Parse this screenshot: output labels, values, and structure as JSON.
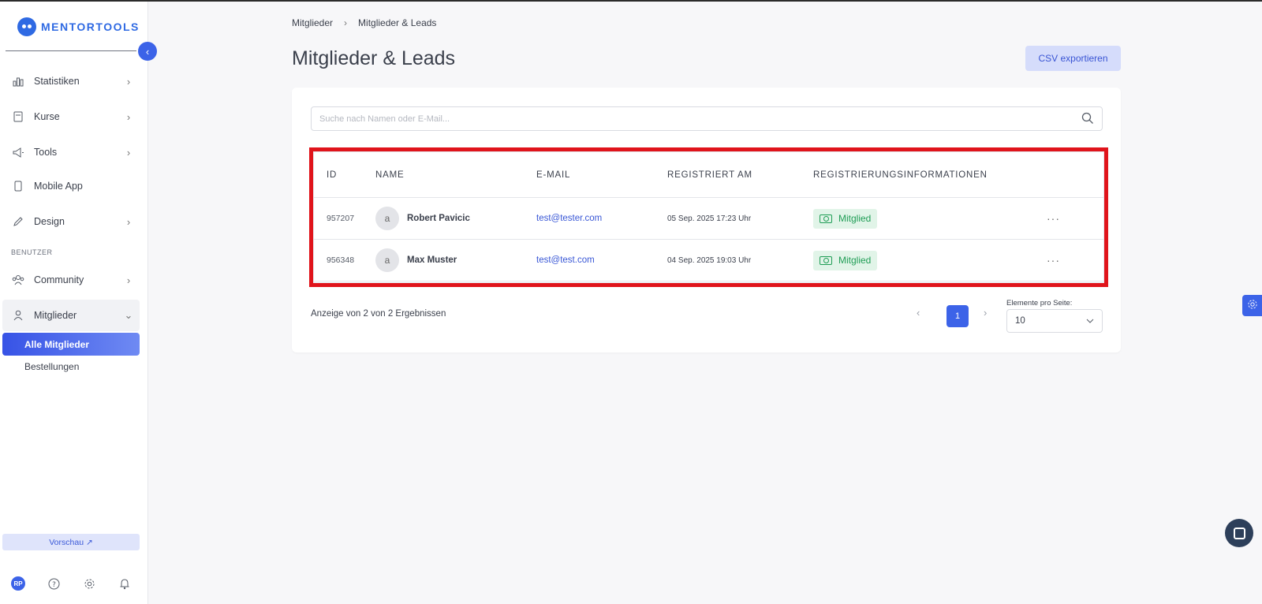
{
  "sidebar": {
    "logo": "MENTORTOOLS",
    "collapse_icon": "chevron-left-icon",
    "items": [
      {
        "label": "Statistiken",
        "icon": "bar-chart-icon"
      },
      {
        "label": "Kurse",
        "icon": "book-icon"
      },
      {
        "label": "Tools",
        "icon": "megaphone-icon"
      },
      {
        "label": "Mobile App",
        "icon": "phone-icon"
      },
      {
        "label": "Design",
        "icon": "pen-icon"
      }
    ],
    "section_label": "BENUTZER",
    "community": "Community",
    "members": "Mitglieder",
    "sub_active": "Alle Mitglieder",
    "sub_item": "Bestellungen",
    "preview": "Vorschau ↗",
    "avatar_initials": "RP"
  },
  "breadcrumb": [
    "Mitglieder",
    "Mitglieder & Leads"
  ],
  "page_title": "Mitglieder & Leads",
  "csv_button": "CSV exportieren",
  "search": {
    "placeholder": "Suche nach Namen oder E-Mail..."
  },
  "table": {
    "headers": {
      "id": "ID",
      "name": "NAME",
      "email": "E-MAIL",
      "registered": "REGISTRIERT AM",
      "info": "REGISTRIERUNGSINFORMATIONEN"
    },
    "rows": [
      {
        "id": "957207",
        "avatar": "a",
        "name": "Robert Pavicic",
        "email": "test@tester.com",
        "registered": "05 Sep. 2025 17:23 Uhr",
        "badge": "Mitglied"
      },
      {
        "id": "956348",
        "avatar": "a",
        "name": "Max Muster",
        "email": "test@test.com",
        "registered": "04 Sep. 2025 19:03 Uhr",
        "badge": "Mitglied"
      }
    ]
  },
  "results_text": "Anzeige von 2 von 2 Ergebnissen",
  "pagination": {
    "current": "1",
    "per_page_label": "Elemente pro Seite:",
    "per_page_value": "10"
  },
  "colors": {
    "accent": "#3c63e8",
    "badge_bg": "#e1f4e8",
    "badge_fg": "#1f9d55",
    "highlight": "#e0141b"
  }
}
